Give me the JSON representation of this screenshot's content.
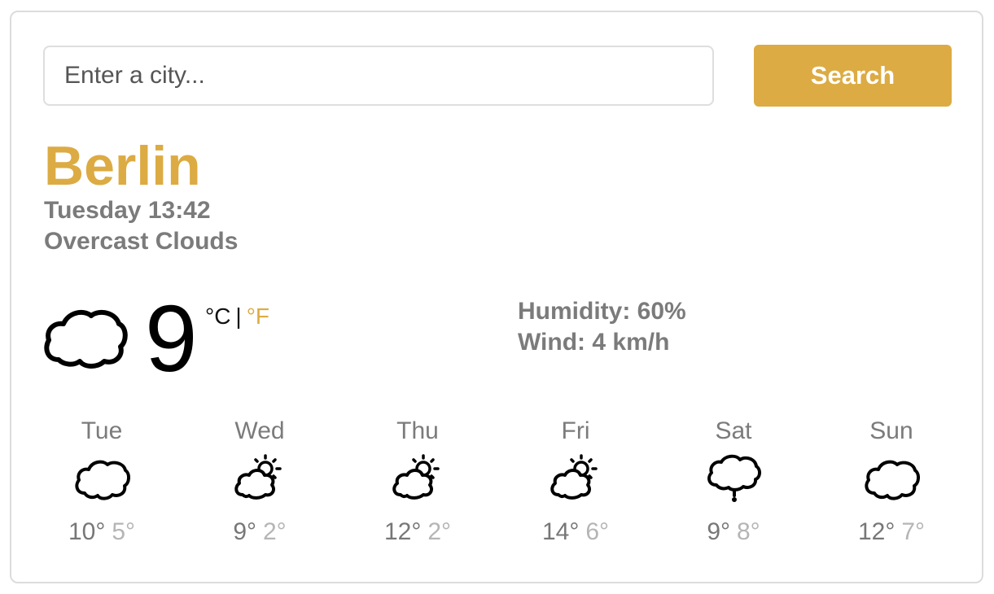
{
  "search": {
    "placeholder": "Enter a city...",
    "value": "",
    "button_label": "Search"
  },
  "location": {
    "city": "Berlin",
    "datetime": "Tuesday 13:42",
    "condition": "Overcast Clouds"
  },
  "current": {
    "icon": "cloud-icon",
    "temperature": "9",
    "unit_c": "°C",
    "unit_separator": "|",
    "unit_f": "°F",
    "humidity": "Humidity: 60%",
    "wind": "Wind: 4 km/h"
  },
  "forecast": [
    {
      "day": "Tue",
      "icon": "cloud-icon",
      "max": "10°",
      "min": "5°"
    },
    {
      "day": "Wed",
      "icon": "partly-sunny-icon",
      "max": "9°",
      "min": "2°"
    },
    {
      "day": "Thu",
      "icon": "partly-sunny-icon",
      "max": "12°",
      "min": "2°"
    },
    {
      "day": "Fri",
      "icon": "partly-sunny-icon",
      "max": "14°",
      "min": "6°"
    },
    {
      "day": "Sat",
      "icon": "drizzle-icon",
      "max": "9°",
      "min": "8°"
    },
    {
      "day": "Sun",
      "icon": "cloud-icon",
      "max": "12°",
      "min": "7°"
    }
  ],
  "colors": {
    "accent": "#dcab43",
    "muted_text": "#7b7b7b",
    "min_temp": "#b5b5b5",
    "border": "#dcdcdc"
  }
}
